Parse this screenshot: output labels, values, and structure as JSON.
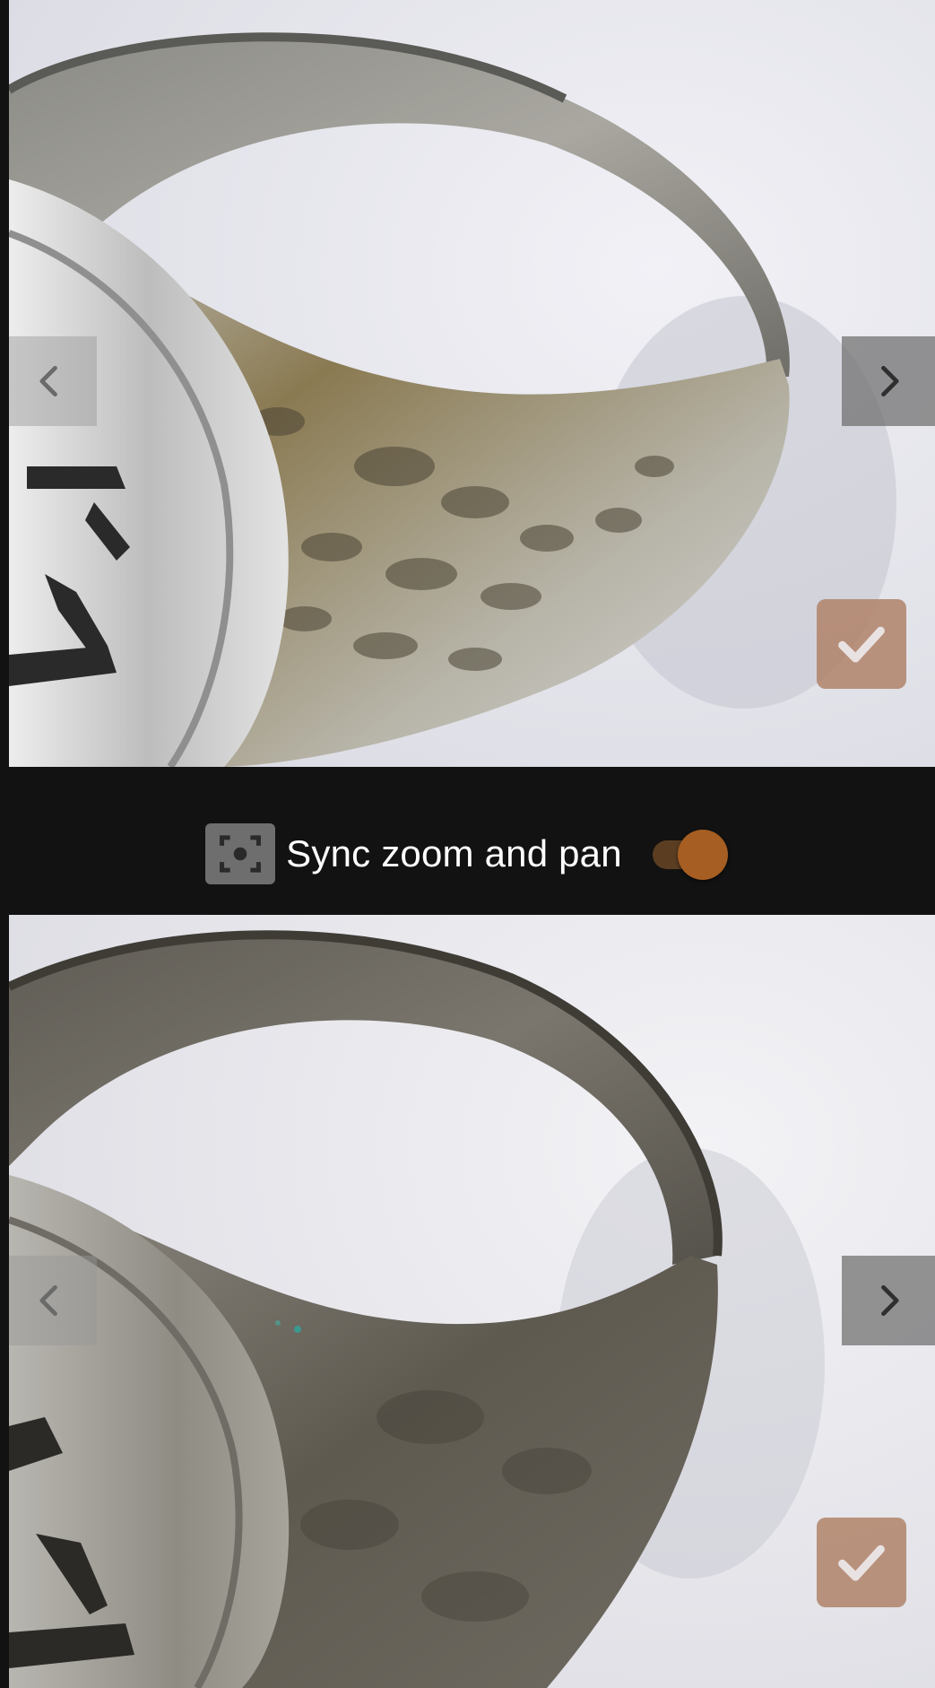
{
  "sync": {
    "label": "Sync zoom and pan",
    "enabled": true,
    "icon": "center-focus-icon"
  },
  "panels": [
    {
      "id": "top",
      "subject": "tarnished silver signet ring, close-up",
      "prev_icon": "chevron-left-icon",
      "next_icon": "chevron-right-icon",
      "select_icon": "checkmark-icon"
    },
    {
      "id": "bottom",
      "subject": "tarnished silver signet ring, close-up",
      "prev_icon": "chevron-left-icon",
      "next_icon": "chevron-right-icon",
      "select_icon": "checkmark-icon"
    }
  ],
  "colors": {
    "background": "#121212",
    "accent": "#a65e22",
    "accent_track": "#5b3e22",
    "select_button": "#b08268",
    "nav_button": "#6e6e6e"
  }
}
